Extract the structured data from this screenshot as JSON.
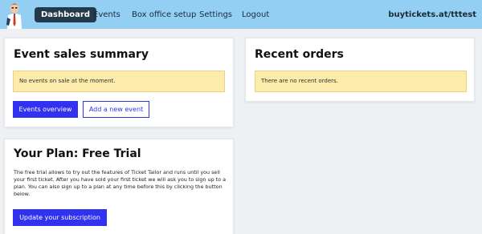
{
  "nav": {
    "items": [
      {
        "label": "Dashboard",
        "active": true
      },
      {
        "label": "Events"
      },
      {
        "label": "Box office setup"
      },
      {
        "label": "Settings"
      },
      {
        "label": "Logout"
      }
    ],
    "account": "buytickets.at/tttest"
  },
  "sales_summary": {
    "title": "Event sales summary",
    "notice": "No events on sale at the moment.",
    "primary_button": "Events overview",
    "secondary_button": "Add a new event"
  },
  "recent_orders": {
    "title": "Recent orders",
    "notice": "There are no recent orders."
  },
  "plan": {
    "title": "Your Plan: Free Trial",
    "description": "The free trial allows to try out the features of Ticket Tailor and runs until you sell your first ticket. After you have sold your first ticket we will ask you to sign up to a plan. You can also sign up to a plan at any time before this by clicking the button below.",
    "button": "Update your subscription"
  },
  "colors": {
    "header": "#92cff3",
    "active_nav": "#233a4d",
    "accent": "#3131f0",
    "notice": "#fcebab"
  }
}
